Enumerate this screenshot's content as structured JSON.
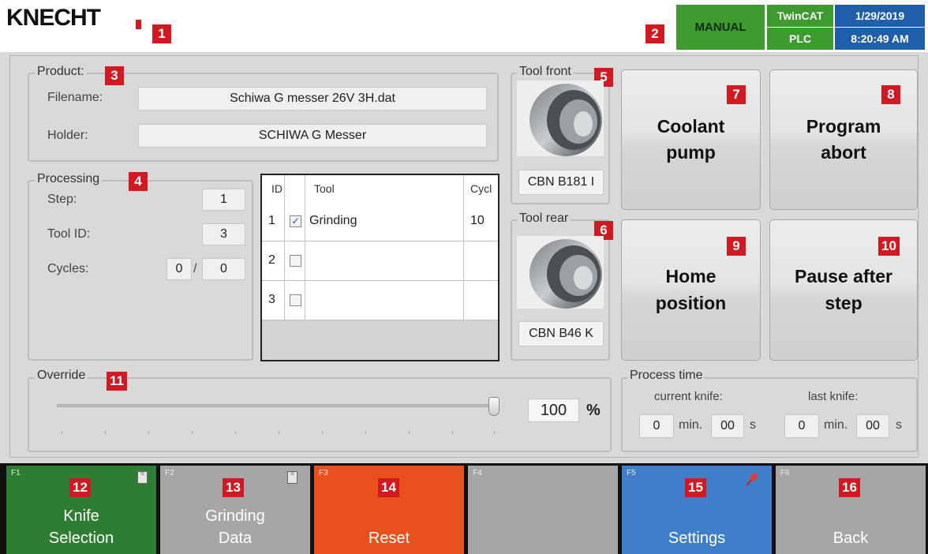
{
  "header": {
    "logo": "KNECHT",
    "mode": "MANUAL",
    "twincat_label": "TwinCAT",
    "plc_label": "PLC",
    "date": "1/29/2019",
    "time": "8:20:49 AM"
  },
  "product": {
    "title": "Product:",
    "filename_label": "Filename:",
    "filename_value": "Schiwa G messer 26V  3H.dat",
    "holder_label": "Holder:",
    "holder_value": "SCHIWA G Messer"
  },
  "processing": {
    "title": "Processing",
    "step_label": "Step:",
    "step_value": "1",
    "toolid_label": "Tool ID:",
    "toolid_value": "3",
    "cycles_label": "Cycles:",
    "cycles_current": "0",
    "cycles_sep": "/",
    "cycles_total": "0"
  },
  "tool_table": {
    "columns": [
      "ID",
      "Tool",
      "Cycl"
    ],
    "rows": [
      {
        "id": "1",
        "checked": true,
        "tool": "Grinding",
        "cycles": "10"
      },
      {
        "id": "2",
        "checked": false,
        "tool": "",
        "cycles": ""
      },
      {
        "id": "3",
        "checked": false,
        "tool": "",
        "cycles": ""
      }
    ]
  },
  "tool_front": {
    "title": "Tool front",
    "name": "CBN B181 I"
  },
  "tool_rear": {
    "title": "Tool rear",
    "name": "CBN B46 K"
  },
  "buttons": {
    "coolant": "Coolant\npump",
    "abort": "Program\nabort",
    "home": "Home\nposition",
    "pause": "Pause after\nstep"
  },
  "override": {
    "title": "Override",
    "value": "100",
    "unit": "%",
    "level": 100
  },
  "process_time": {
    "title": "Process time",
    "current_label": "current knife:",
    "last_label": "last knife:",
    "current_min": "0",
    "current_sec": "00",
    "last_min": "0",
    "last_sec": "00",
    "min_unit": "min.",
    "sec_unit": "s"
  },
  "fkeys": [
    {
      "key": "F1",
      "label": "Knife\nSelection",
      "color": "#2e7d32",
      "icon": "document-icon"
    },
    {
      "key": "F2",
      "label": "Grinding\nData",
      "color": "#a6a6a6",
      "icon": "document-icon"
    },
    {
      "key": "F3",
      "label": "Reset",
      "color": "#e8501c",
      "icon": ""
    },
    {
      "key": "F4",
      "label": "",
      "color": "#a6a6a6",
      "icon": ""
    },
    {
      "key": "F5",
      "label": "Settings",
      "color": "#3f7fc9",
      "icon": "pin-icon"
    },
    {
      "key": "F6",
      "label": "Back",
      "color": "#a6a6a6",
      "icon": ""
    }
  ],
  "markers": [
    "1",
    "2",
    "3",
    "4",
    "5",
    "6",
    "7",
    "8",
    "9",
    "10",
    "11",
    "12",
    "13",
    "14",
    "15",
    "16"
  ],
  "colors": {
    "marker": "#d21921",
    "manual_green": "#3d9a2f",
    "twincat_green": "#3d9a2f",
    "datetime_blue": "#1f5ea8"
  }
}
